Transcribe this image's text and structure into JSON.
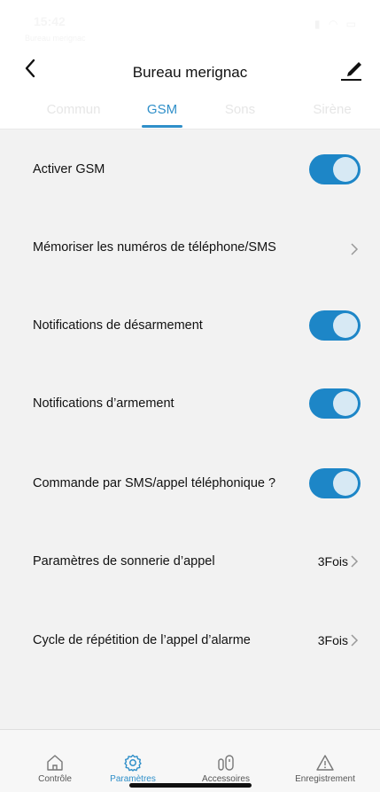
{
  "status_bar": {
    "time": "15:42",
    "subtitle": "Bureau merignac"
  },
  "navbar": {
    "title": "Bureau merignac",
    "back_icon": "chevron-left-icon",
    "edit_icon": "pencil-icon"
  },
  "tabs": [
    {
      "label": "Commun",
      "active": false
    },
    {
      "label": "GSM",
      "active": true
    },
    {
      "label": "Sons",
      "active": false
    },
    {
      "label": "Sirène",
      "active": false
    }
  ],
  "settings": [
    {
      "label": "Activer GSM",
      "type": "toggle",
      "on": true
    },
    {
      "label": "Mémoriser les numéros de téléphone/SMS",
      "type": "link"
    },
    {
      "label": "Notifications de désarmement",
      "type": "toggle",
      "on": true
    },
    {
      "label": "Notifications d’armement",
      "type": "toggle",
      "on": true
    },
    {
      "label": "Commande par SMS/appel téléphonique ?",
      "type": "toggle",
      "on": true
    },
    {
      "label": "Paramètres de sonnerie d’appel",
      "type": "value",
      "value": "3Fois"
    },
    {
      "label": "Cycle de répétition de l’appel d’alarme",
      "type": "value",
      "value": "3Fois"
    }
  ],
  "bottom_nav": [
    {
      "label": "Contrôle",
      "icon": "home-icon",
      "active": false
    },
    {
      "label": "Paramètres",
      "icon": "gear-icon",
      "active": true
    },
    {
      "label": "Accessoires",
      "icon": "sensor-icon",
      "active": false
    },
    {
      "label": "Enregistrement",
      "icon": "warning-icon",
      "active": false
    }
  ],
  "colors": {
    "accent": "#2f8fc9",
    "toggle_on": "#1d86c7",
    "background": "#f2f2f2"
  }
}
